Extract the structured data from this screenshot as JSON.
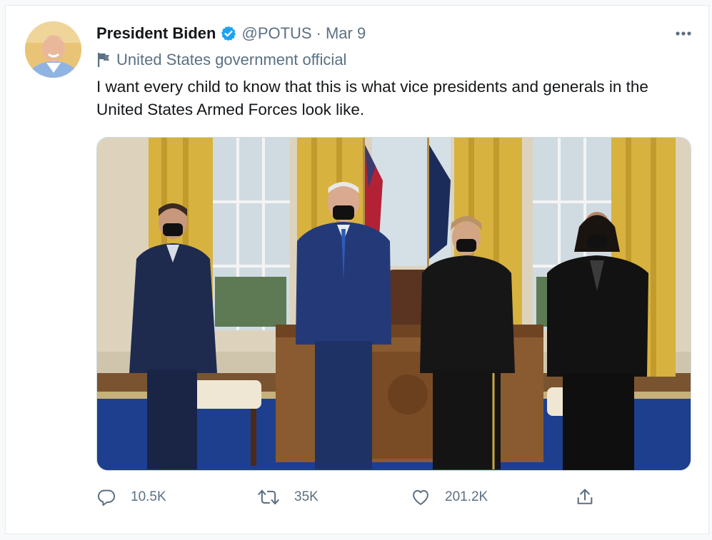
{
  "tweet": {
    "author_name": "President Biden",
    "handle": "@POTUS",
    "separator": "·",
    "date": "Mar 9",
    "label": "United States government official",
    "text": "I want every child to know that this is what vice presidents and generals in the United States Armed Forces look like.",
    "media_alt": "Photo in the Oval Office"
  },
  "actions": {
    "reply_count": "10.5K",
    "retweet_count": "35K",
    "like_count": "201.2K"
  },
  "icons": {
    "verified": "verified-badge-icon",
    "more": "more-options-icon",
    "label": "flag-icon",
    "reply": "reply-icon",
    "retweet": "retweet-icon",
    "like": "heart-icon",
    "share": "share-icon"
  },
  "colors": {
    "verified_blue": "#1da1f2",
    "secondary_text": "#5b7083",
    "primary_text": "#14171a"
  }
}
